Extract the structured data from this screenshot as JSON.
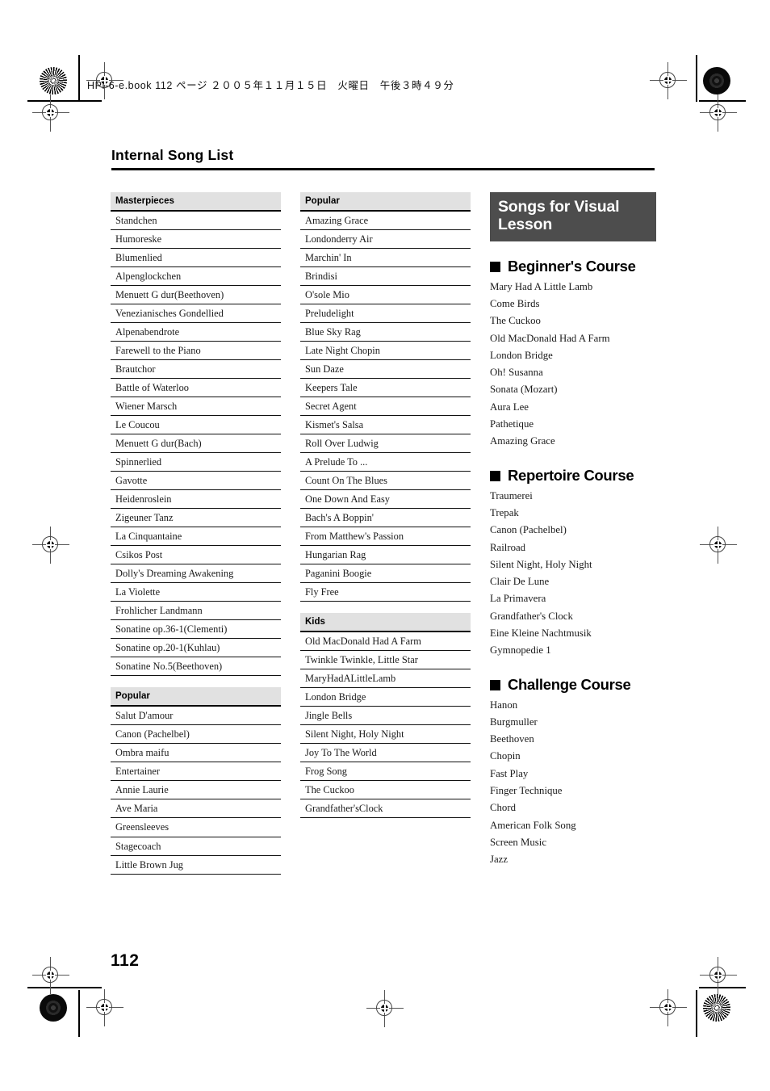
{
  "meta": {
    "book_info": "HPi-6-e.book 112 ページ ２００５年１１月１５日　火曜日　午後３時４９分",
    "page_title": "Internal Song List",
    "folio": "112"
  },
  "columns": {
    "col1": [
      {
        "header": "Masterpieces",
        "items": [
          "Standchen",
          "Humoreske",
          "Blumenlied",
          "Alpenglockchen",
          "Menuett G dur(Beethoven)",
          "Venezianisches Gondellied",
          "Alpenabendrote",
          "Farewell to the Piano",
          "Brautchor",
          "Battle of Waterloo",
          "Wiener Marsch",
          "Le Coucou",
          "Menuett G dur(Bach)",
          "Spinnerlied",
          "Gavotte",
          "Heidenroslein",
          "Zigeuner Tanz",
          "La Cinquantaine",
          "Csikos Post",
          "Dolly's Dreaming Awakening",
          "La Violette",
          "Frohlicher Landmann",
          "Sonatine op.36-1(Clementi)",
          "Sonatine op.20-1(Kuhlau)",
          "Sonatine No.5(Beethoven)"
        ]
      },
      {
        "header": "Popular",
        "items": [
          "Salut D'amour",
          "Canon (Pachelbel)",
          "Ombra maifu",
          "Entertainer",
          "Annie Laurie",
          "Ave Maria",
          "Greensleeves",
          "Stagecoach",
          "Little Brown Jug"
        ]
      }
    ],
    "col2": [
      {
        "header": "Popular",
        "items": [
          "Amazing Grace",
          "Londonderry Air",
          "Marchin' In",
          "Brindisi",
          "O'sole Mio",
          "Preludelight",
          "Blue Sky Rag",
          "Late Night Chopin",
          "Sun Daze",
          "Keepers Tale",
          "Secret Agent",
          "Kismet's Salsa",
          "Roll Over Ludwig",
          "A Prelude To ...",
          "Count On The Blues",
          "One Down And Easy",
          "Bach's A Boppin'",
          "From Matthew's Passion",
          "Hungarian Rag",
          "Paganini Boogie",
          "Fly Free"
        ]
      },
      {
        "header": "Kids",
        "items": [
          "Old MacDonald Had A Farm",
          "Twinkle Twinkle, Little Star",
          "MaryHadALittleLamb",
          "London Bridge",
          "Jingle Bells",
          "Silent Night, Holy Night",
          "Joy To The World",
          "Frog Song",
          "The Cuckoo",
          "Grandfather'sClock"
        ]
      }
    ],
    "col3": {
      "banner": "Songs for Visual Lesson",
      "courses": [
        {
          "title": "Beginner's Course",
          "items": [
            "Mary Had A Little Lamb",
            "Come Birds",
            "The Cuckoo",
            "Old MacDonald Had A Farm",
            "London Bridge",
            "Oh! Susanna",
            "Sonata (Mozart)",
            "Aura Lee",
            "Pathetique",
            "Amazing Grace"
          ]
        },
        {
          "title": "Repertoire Course",
          "items": [
            "Traumerei",
            "Trepak",
            "Canon (Pachelbel)",
            "Railroad",
            "Silent Night, Holy Night",
            "Clair De Lune",
            "La Primavera",
            "Grandfather's Clock",
            "Eine Kleine Nachtmusik",
            "Gymnopedie 1"
          ]
        },
        {
          "title": "Challenge Course",
          "items": [
            "Hanon",
            "Burgmuller",
            "Beethoven",
            "Chopin",
            "Fast Play",
            "Finger Technique",
            "Chord",
            "American Folk Song",
            "Screen Music",
            "Jazz"
          ]
        }
      ]
    }
  },
  "colors": {
    "banner_bg": "#4d4d4d",
    "table_header_bg": "#e1e1e1",
    "rule": "#000000"
  }
}
